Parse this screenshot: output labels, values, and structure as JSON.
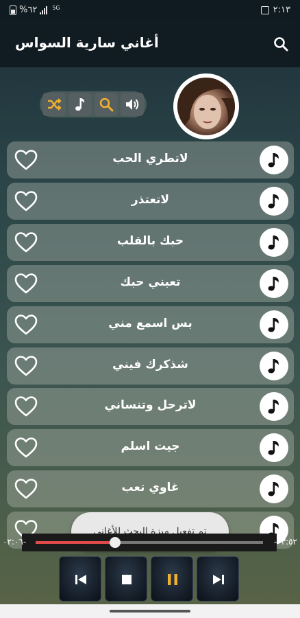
{
  "status": {
    "battery": "%٦٢",
    "network": "5G",
    "time": "٢:١٣"
  },
  "app": {
    "title": "أغاني سارية السواس",
    "search_icon": "search-icon"
  },
  "tools": [
    {
      "icon": "shuffle-icon"
    },
    {
      "icon": "music-note-icon"
    },
    {
      "icon": "search-icon"
    },
    {
      "icon": "volume-icon"
    }
  ],
  "songs": [
    {
      "title": "لاتطري الحب"
    },
    {
      "title": "لاتعتذر"
    },
    {
      "title": "حبك بالقلب"
    },
    {
      "title": "تعبني حبك"
    },
    {
      "title": "بس اسمع مني"
    },
    {
      "title": "شذكرك فيني"
    },
    {
      "title": "لاترحل وتنساني"
    },
    {
      "title": "جيت اسلم"
    },
    {
      "title": "غاوي تعب"
    },
    {
      "title": ""
    }
  ],
  "toast": {
    "text": "تم تفعيل ميزة البحث للأغاني"
  },
  "player": {
    "elapsed": "٠٢:٠٦-",
    "remaining": "-٠٣:٥٢",
    "progress": 0.35,
    "accent": "#e04a4a",
    "controls": [
      {
        "icon": "previous-icon"
      },
      {
        "icon": "stop-icon"
      },
      {
        "icon": "pause-icon"
      },
      {
        "icon": "next-icon"
      }
    ]
  }
}
